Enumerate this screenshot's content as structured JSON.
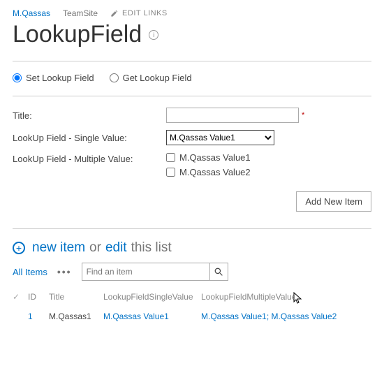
{
  "breadcrumb": {
    "site": "M.Qassas",
    "team": "TeamSite",
    "edit_links": "EDIT LINKS"
  },
  "page_title": "LookupField",
  "radios": {
    "set_label": "Set Lookup Field",
    "get_label": "Get Lookup Field"
  },
  "form": {
    "title_label": "Title:",
    "title_value": "",
    "single_label": "LookUp Field - Single Value:",
    "single_selected": "M.Qassas Value1",
    "multi_label": "LookUp Field - Multiple Value:",
    "multi_options": {
      "opt1": "M.Qassas Value1",
      "opt2": "M.Qassas Value2"
    },
    "add_button": "Add New Item"
  },
  "list": {
    "new_item": "new item",
    "or": "or",
    "edit": "edit",
    "this_list": "this list",
    "view": "All Items",
    "search_placeholder": "Find an item",
    "columns": {
      "id": "ID",
      "title": "Title",
      "single": "LookupFieldSingleValue",
      "multi": "LookupFieldMultipleValue"
    },
    "row": {
      "id": "1",
      "title": "M.Qassas1",
      "single": "M.Qassas Value1",
      "multi": "M.Qassas Value1; M.Qassas Value2"
    }
  }
}
